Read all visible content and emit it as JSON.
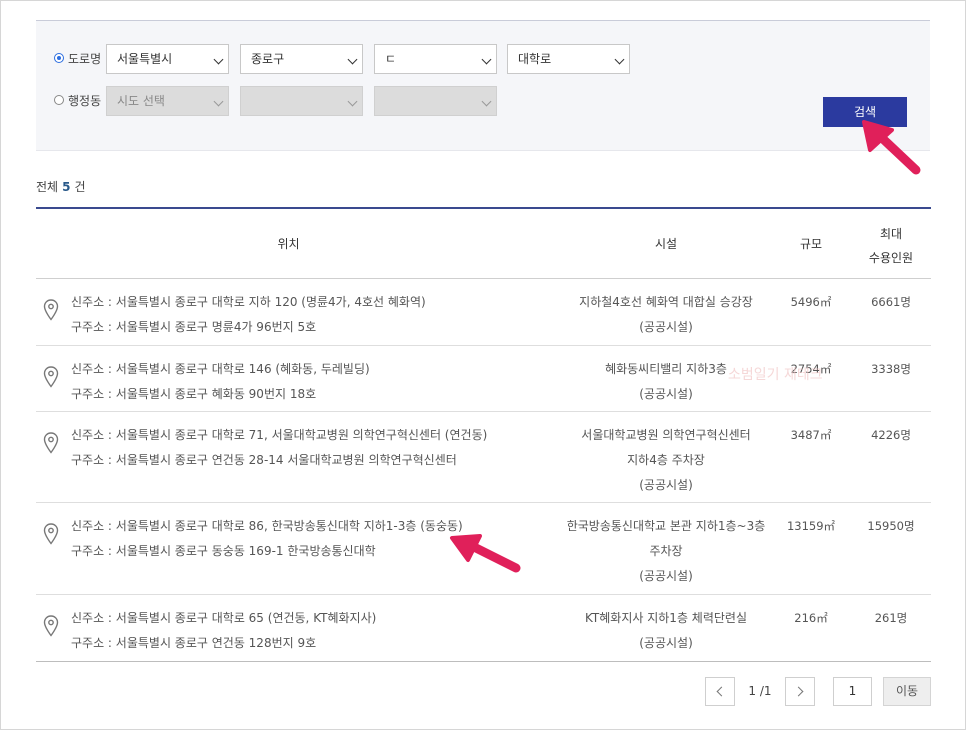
{
  "search": {
    "radio_road": "도로명",
    "radio_admin": "행정동",
    "road_selects": [
      "서울특별시",
      "종로구",
      "ㄷ",
      "대학로"
    ],
    "admin_selects": [
      "시도 선택",
      "",
      ""
    ],
    "search_button": "검색"
  },
  "summary": {
    "prefix": "전체",
    "count": "5",
    "suffix": "건"
  },
  "table": {
    "headers": {
      "location": "위치",
      "facility": "시설",
      "scale": "규모",
      "capacity_line1": "최대",
      "capacity_line2": "수용인원"
    },
    "rows": [
      {
        "new_addr": "신주소 : 서울특별시 종로구 대학로 지하 120 (명륜4가, 4호선 혜화역)",
        "old_addr": "구주소 : 서울특별시 종로구 명륜4가 96번지 5호",
        "facility": [
          "지하철4호선 혜화역 대합실 승강장",
          "(공공시설)"
        ],
        "scale": "5496㎡",
        "capacity": "6661명"
      },
      {
        "new_addr": "신주소 : 서울특별시 종로구 대학로 146 (혜화동, 두레빌딩)",
        "old_addr": "구주소 : 서울특별시 종로구 혜화동 90번지 18호",
        "facility": [
          "혜화동씨티밸리 지하3층",
          "(공공시설)"
        ],
        "scale": "2754㎡",
        "capacity": "3338명"
      },
      {
        "new_addr": "신주소 : 서울특별시 종로구 대학로 71, 서울대학교병원 의학연구혁신센터 (연건동)",
        "old_addr": "구주소 : 서울특별시 종로구 연건동 28-14 서울대학교병원 의학연구혁신센터",
        "facility": [
          "서울대학교병원 의학연구혁신센터",
          "지하4층 주차장",
          "(공공시설)"
        ],
        "scale": "3487㎡",
        "capacity": "4226명"
      },
      {
        "new_addr": "신주소 : 서울특별시 종로구 대학로 86, 한국방송통신대학 지하1-3층 (동숭동)",
        "old_addr": "구주소 : 서울특별시 종로구 동숭동 169-1 한국방송통신대학",
        "facility": [
          "한국방송통신대학교 본관 지하1층~3층",
          "주차장",
          "(공공시설)"
        ],
        "scale": "13159㎡",
        "capacity": "15950명"
      },
      {
        "new_addr": "신주소 : 서울특별시 종로구 대학로 65 (연건동, KT혜화지사)",
        "old_addr": "구주소 : 서울특별시 종로구 연건동 128번지 9호",
        "facility": [
          "KT혜화지사 지하1층 체력단련실",
          "(공공시설)"
        ],
        "scale": "216㎡",
        "capacity": "261명"
      }
    ]
  },
  "watermark": "소범일기 재테크",
  "pagination": {
    "page_info": "1 /1",
    "page_input": "1",
    "go_button": "이동"
  },
  "colors": {
    "accent": "#2b3a9f",
    "arrow": "#e0205a"
  }
}
